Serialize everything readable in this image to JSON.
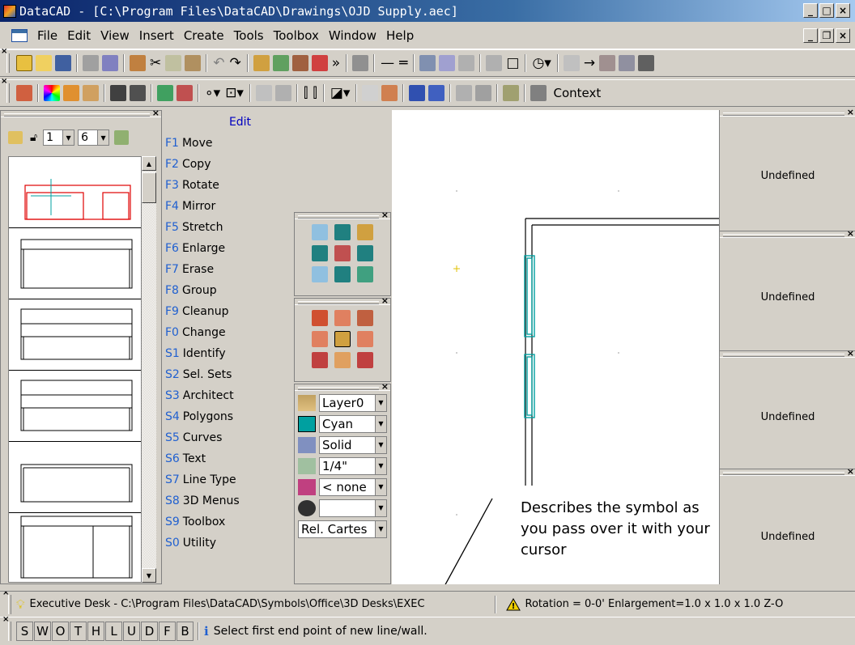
{
  "window": {
    "title": "DataCAD - [C:\\Program Files\\DataCAD\\Drawings\\OJD Supply.aec]"
  },
  "menu": [
    "File",
    "Edit",
    "View",
    "Insert",
    "Create",
    "Tools",
    "Toolbox",
    "Window",
    "Help"
  ],
  "toolbar2": {
    "context_label": "Context"
  },
  "symbol_panel": {
    "combo1": "1",
    "combo2": "6"
  },
  "edit_menu": {
    "title": "Edit",
    "items": [
      {
        "key": "F1",
        "label": "Move"
      },
      {
        "key": "F2",
        "label": "Copy"
      },
      {
        "key": "F3",
        "label": "Rotate"
      },
      {
        "key": "F4",
        "label": "Mirror"
      },
      {
        "key": "F5",
        "label": "Stretch"
      },
      {
        "key": "F6",
        "label": "Enlarge"
      },
      {
        "key": "F7",
        "label": "Erase"
      },
      {
        "key": "F8",
        "label": "Group"
      },
      {
        "key": "F9",
        "label": "Cleanup"
      },
      {
        "key": "F0",
        "label": "Change"
      },
      {
        "key": "S1",
        "label": "Identify"
      },
      {
        "key": "S2",
        "label": "Sel. Sets"
      },
      {
        "key": "S3",
        "label": "Architect"
      },
      {
        "key": "S4",
        "label": "Polygons"
      },
      {
        "key": "S5",
        "label": "Curves"
      },
      {
        "key": "S6",
        "label": "Text"
      },
      {
        "key": "S7",
        "label": "Line Type"
      },
      {
        "key": "S8",
        "label": "3D Menus"
      },
      {
        "key": "S9",
        "label": "Toolbox"
      },
      {
        "key": "S0",
        "label": "Utility"
      }
    ]
  },
  "properties": {
    "layer": "Layer0",
    "color": "Cyan",
    "linetype": "Solid",
    "spacing": "1/4\"",
    "hatch": "< none",
    "view": "",
    "coords": "Rel. Cartes"
  },
  "view_panels": [
    "Undefined",
    "Undefined",
    "Undefined",
    "Undefined"
  ],
  "callout": {
    "text": "Describes the symbol as you pass over it with your cursor"
  },
  "status": {
    "symbol_path": "Executive Desk - C:\\Program Files\\DataCAD\\Symbols\\Office\\3D Desks\\EXEC",
    "readout": "Rotation = 0-0'  Enlargement=1.0 x 1.0 x 1.0  Z-O",
    "keys": [
      "S",
      "W",
      "O",
      "T",
      "H",
      "L",
      "U",
      "D",
      "F",
      "B"
    ],
    "prompt": "Select first end point of new line/wall."
  },
  "colors": {
    "title_start": "#0a246a",
    "cyan": "#00a0a0",
    "symbol_red": "#e00000",
    "fkey": "#2060d0"
  }
}
